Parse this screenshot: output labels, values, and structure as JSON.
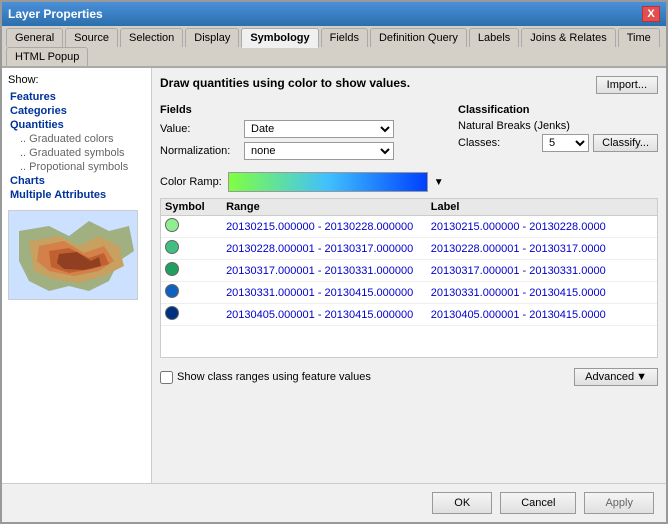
{
  "window": {
    "title": "Layer Properties",
    "close_label": "X"
  },
  "tabs": [
    {
      "id": "general",
      "label": "General"
    },
    {
      "id": "source",
      "label": "Source"
    },
    {
      "id": "selection",
      "label": "Selection"
    },
    {
      "id": "display",
      "label": "Display"
    },
    {
      "id": "symbology",
      "label": "Symbology",
      "active": true
    },
    {
      "id": "fields",
      "label": "Fields"
    },
    {
      "id": "definition_query",
      "label": "Definition Query"
    },
    {
      "id": "labels",
      "label": "Labels"
    },
    {
      "id": "joins_relates",
      "label": "Joins & Relates"
    },
    {
      "id": "time",
      "label": "Time"
    },
    {
      "id": "html_popup",
      "label": "HTML Popup"
    }
  ],
  "left_panel": {
    "show_label": "Show:",
    "items": [
      {
        "id": "features",
        "label": "Features",
        "type": "section"
      },
      {
        "id": "categories",
        "label": "Categories",
        "type": "section"
      },
      {
        "id": "quantities",
        "label": "Quantities",
        "type": "section"
      },
      {
        "id": "graduated_colors",
        "label": "Graduated colors",
        "type": "sub"
      },
      {
        "id": "graduated_symbols",
        "label": "Graduated symbols",
        "type": "sub"
      },
      {
        "id": "proportional_symbols",
        "label": "Propotional symbols",
        "type": "sub"
      },
      {
        "id": "charts",
        "label": "Charts",
        "type": "section"
      },
      {
        "id": "multiple_attributes",
        "label": "Multiple Attributes",
        "type": "section"
      }
    ]
  },
  "main": {
    "draw_title": "Draw quantities using color to show values.",
    "import_button": "Import...",
    "fields": {
      "label": "Fields",
      "value_label": "Value:",
      "value_selected": "Date",
      "normalization_label": "Normalization:",
      "normalization_selected": "none"
    },
    "classification": {
      "label": "Classification",
      "method": "Natural Breaks (Jenks)",
      "classes_label": "Classes:",
      "classes_value": "5",
      "classify_button": "Classify..."
    },
    "color_ramp": {
      "label": "Color Ramp:"
    },
    "table": {
      "headers": [
        "Symbol",
        "Range",
        "Label"
      ],
      "rows": [
        {
          "color": "#90ee90",
          "range": "20130215.000000 - 20130228.000000",
          "label": "20130215.000000 - 20130228.0000"
        },
        {
          "color": "#40c080",
          "range": "20130228.000001 - 20130317.000000",
          "label": "20130228.000001 - 20130317.0000"
        },
        {
          "color": "#20a060",
          "range": "20130317.000001 - 20130331.000000",
          "label": "20130317.000001 - 20130331.0000"
        },
        {
          "color": "#1060c0",
          "range": "20130331.000001 - 20130415.000000",
          "label": "20130331.000001 - 20130415.0000"
        },
        {
          "color": "#003080",
          "range": "20130405.000001 - 20130415.000000",
          "label": "20130405.000001 - 20130415.0000"
        }
      ]
    },
    "show_class_ranges": "Show class ranges using feature values",
    "advanced_button": "Advanced",
    "footer": {
      "ok_label": "OK",
      "cancel_label": "Cancel",
      "apply_label": "Apply"
    }
  }
}
